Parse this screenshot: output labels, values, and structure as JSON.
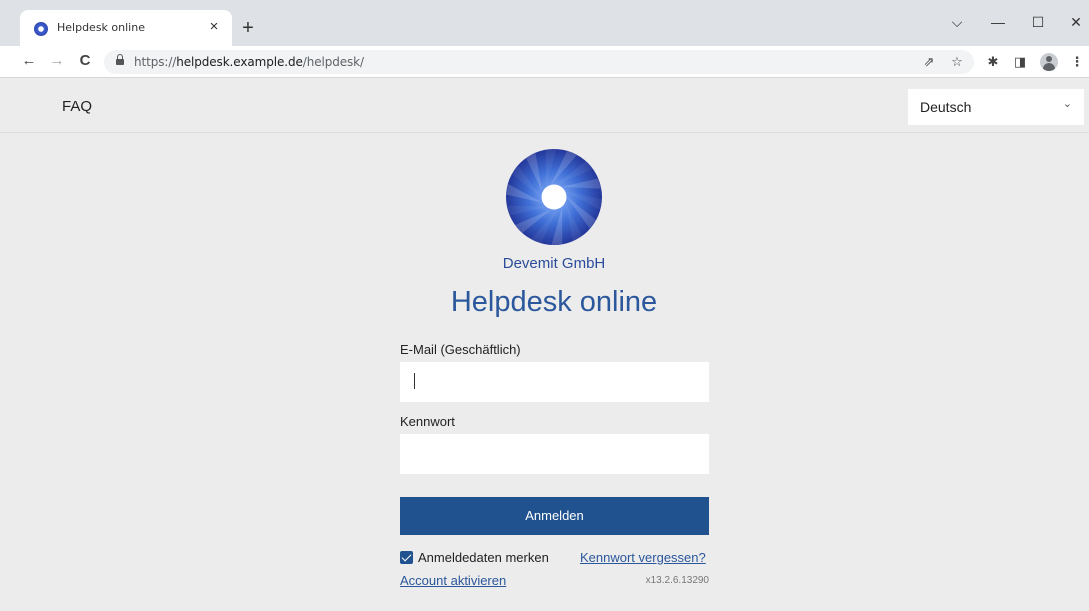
{
  "browser": {
    "tab_title": "Helpdesk online",
    "tab_close": "×",
    "new_tab": "+",
    "url_scheme": "https://",
    "url_host": "helpdesk.example.de",
    "url_path": "/helpdesk/",
    "controls": {
      "dropdown": "⌵",
      "minimize": "—",
      "maximize": "☐",
      "close": "✕"
    },
    "nav": {
      "back": "←",
      "forward": "→",
      "reload": "C"
    },
    "toolbar_icons": {
      "share": "⇗",
      "bookmark": "☆",
      "extensions": "✱",
      "sidepanel": "◨",
      "menu": "⋮"
    }
  },
  "page": {
    "nav": {
      "faq": "FAQ"
    },
    "language": {
      "selected": "Deutsch",
      "chevron": "⌄"
    },
    "company": "Devemit GmbH",
    "title": "Helpdesk online",
    "form": {
      "email_label": "E-Mail (Geschäftlich)",
      "email_value": "",
      "password_label": "Kennwort",
      "password_value": "",
      "submit_label": "Anmelden",
      "remember_label": "Anmeldedaten merken",
      "remember_checked": true,
      "forgot_label": "Kennwort vergessen?",
      "activate_label": "Account aktivieren"
    },
    "version": "x13.2.6.13290"
  },
  "colors": {
    "primary": "#20528f",
    "title": "#2b579c",
    "background": "#ececec"
  }
}
